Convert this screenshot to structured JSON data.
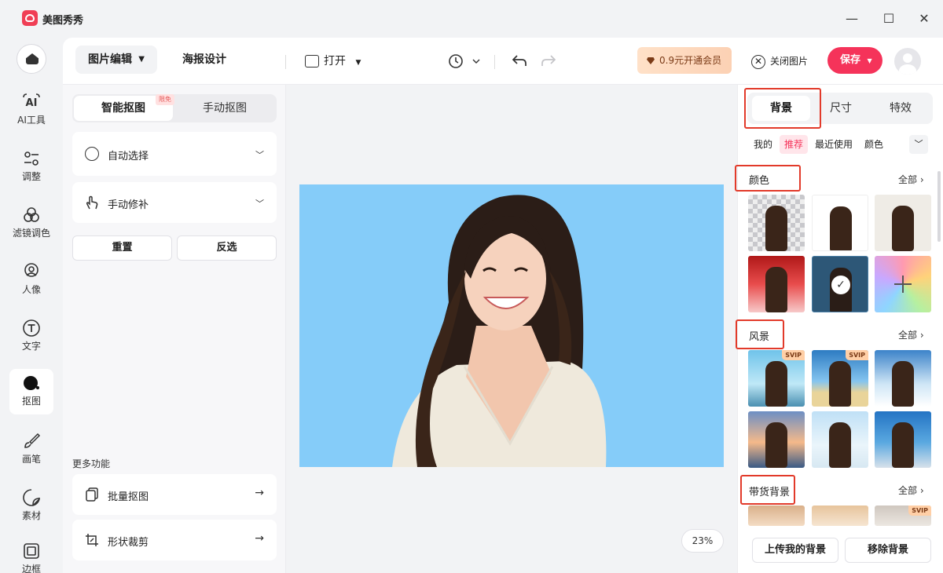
{
  "app": {
    "title": "美图秀秀"
  },
  "window": {
    "minimize": "—",
    "maximize": "☐",
    "close": "✕"
  },
  "nav": {
    "items": [
      {
        "label": "AI工具",
        "icon": "ai-icon"
      },
      {
        "label": "调整",
        "icon": "adjust-icon"
      },
      {
        "label": "滤镜调色",
        "icon": "filter-icon"
      },
      {
        "label": "人像",
        "icon": "portrait-icon"
      },
      {
        "label": "文字",
        "icon": "text-icon"
      },
      {
        "label": "抠图",
        "icon": "cutout-icon",
        "active": true
      },
      {
        "label": "画笔",
        "icon": "brush-icon"
      },
      {
        "label": "素材",
        "icon": "sticker-icon"
      },
      {
        "label": "边框",
        "icon": "frame-icon"
      }
    ]
  },
  "toolbar": {
    "tab_image_edit": "图片编辑",
    "tab_poster": "海报设计",
    "open_label": "打开",
    "vip_label": "0.9元开通会员",
    "close_image_label": "关闭图片",
    "save_label": "保存"
  },
  "left_panel": {
    "segment_smart": "智能抠图",
    "segment_manual": "手动抠图",
    "free_badge": "限免",
    "auto_select": "自动选择",
    "manual_fix": "手动修补",
    "reset": "重置",
    "invert": "反选",
    "more_title": "更多功能",
    "batch_cutout": "批量抠图",
    "shape_crop": "形状裁剪"
  },
  "canvas": {
    "zoom": "23%",
    "background_color": "#85ccf9"
  },
  "right_panel": {
    "tabs": [
      "背景",
      "尺寸",
      "特效"
    ],
    "active_tab": "背景",
    "subtabs": [
      "我的",
      "推荐",
      "最近使用",
      "颜色"
    ],
    "active_subtab": "推荐",
    "sections": {
      "color": {
        "title": "颜色",
        "all": "全部"
      },
      "scenery": {
        "title": "风景",
        "all": "全部"
      },
      "goods": {
        "title": "带货背景",
        "all": "全部"
      }
    },
    "svip_badge": "SVIP",
    "upload_bg": "上传我的背景",
    "remove_bg": "移除背景"
  },
  "colors": {
    "accent": "#f5335a",
    "highlight_box": "#e23a2a",
    "vip_text": "#7b3b17"
  }
}
